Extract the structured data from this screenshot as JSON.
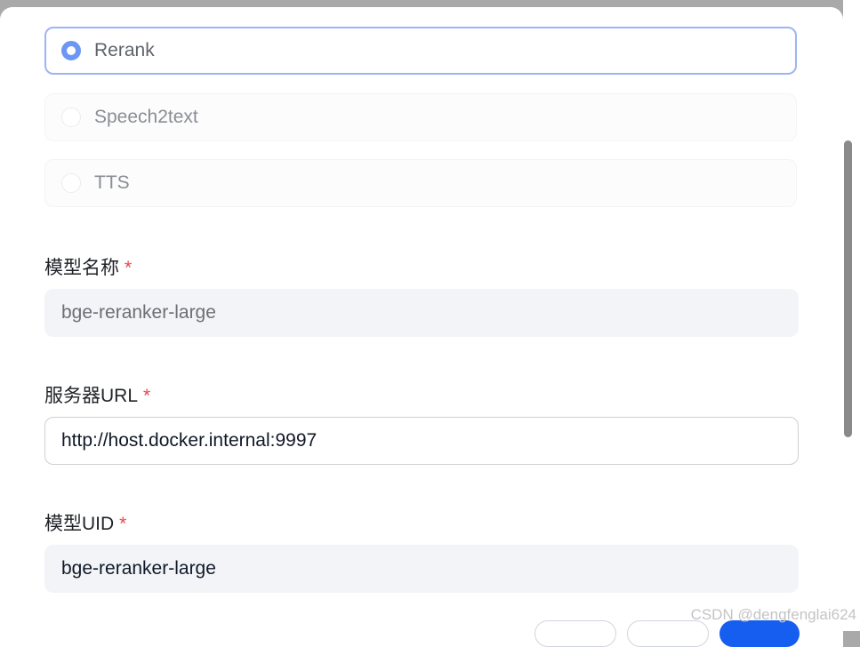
{
  "model_types": {
    "options": [
      {
        "label": "Rerank",
        "selected": true
      },
      {
        "label": "Speech2text",
        "selected": false
      },
      {
        "label": "TTS",
        "selected": false
      }
    ]
  },
  "fields": {
    "model_name": {
      "label": "模型名称",
      "required_mark": "*",
      "value": "bge-reranker-large"
    },
    "server_url": {
      "label": "服务器URL",
      "required_mark": "*",
      "value": "http://host.docker.internal:9997"
    },
    "model_uid": {
      "label": "模型UID",
      "required_mark": "*",
      "value": "bge-reranker-large"
    }
  },
  "watermark": "CSDN @dengfenglai624",
  "colors": {
    "accent": "#6d97f4",
    "primary_button": "#155eef",
    "required": "#e5484d"
  }
}
